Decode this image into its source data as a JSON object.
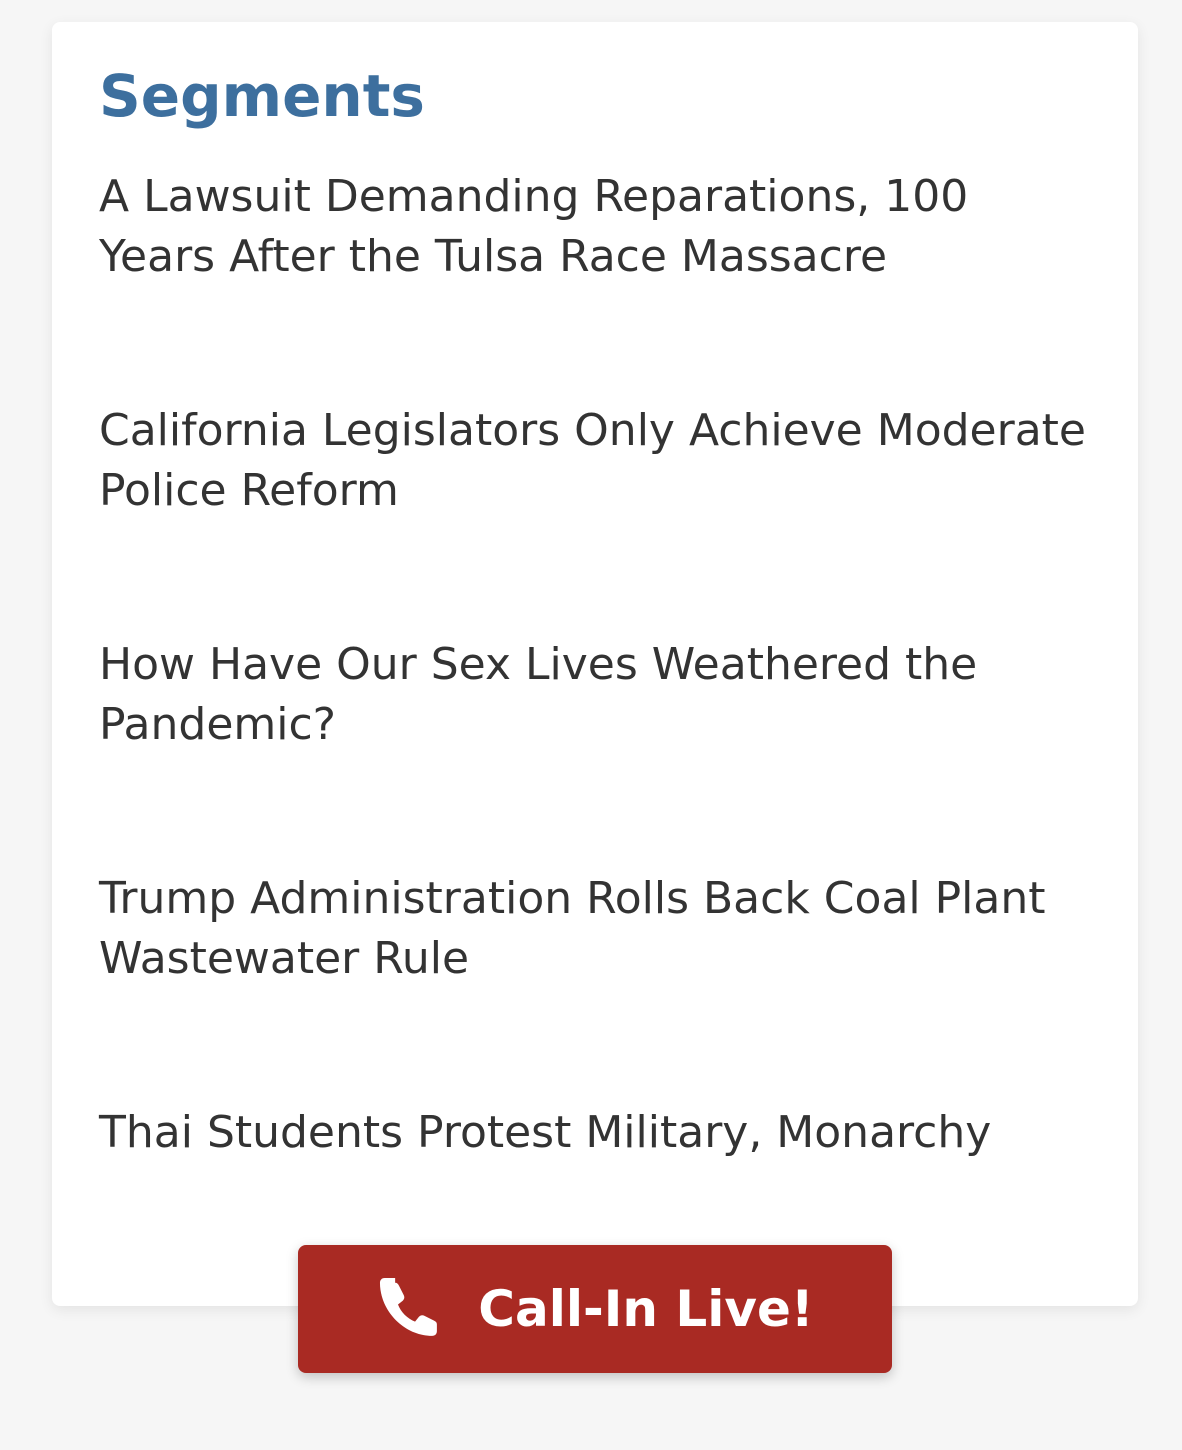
{
  "card": {
    "title": "Segments"
  },
  "segments": [
    {
      "label": "A Lawsuit Demanding Reparations, 100 Years After the Tulsa Race Massacre"
    },
    {
      "label": "California Legislators Only Achieve Moderate Police Reform"
    },
    {
      "label": "How Have Our Sex Lives Weathered the Pandemic?"
    },
    {
      "label": "Trump Administration Rolls Back Coal Plant Wastewater Rule"
    },
    {
      "label": "Thai Students Protest Military, Monarchy"
    }
  ],
  "call_button": {
    "label": "Call-In Live!",
    "icon": "phone-icon"
  },
  "colors": {
    "title": "#3d6f9e",
    "text": "#333333",
    "button": "#a92a23",
    "button_text": "#ffffff",
    "background": "#f6f6f6",
    "card": "#ffffff"
  }
}
